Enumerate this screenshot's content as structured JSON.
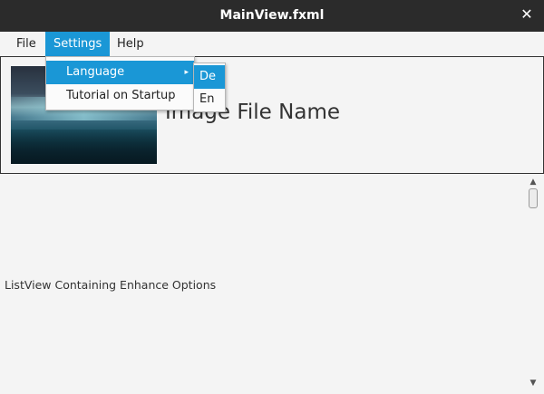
{
  "window": {
    "title": "MainView.fxml",
    "close_glyph": "✕"
  },
  "menubar": {
    "items": [
      {
        "label": "File"
      },
      {
        "label": "Settings"
      },
      {
        "label": "Help"
      }
    ]
  },
  "settings_menu": {
    "items": [
      {
        "label": "Language",
        "arrow": "▸"
      },
      {
        "label": "Tutorial on Startup"
      }
    ]
  },
  "language_submenu": {
    "items": [
      {
        "label": "De"
      },
      {
        "label": "En"
      }
    ]
  },
  "header": {
    "image_file_name": "Image File Name"
  },
  "list": {
    "placeholder": "ListView Containing Enhance Options"
  },
  "scrollbar": {
    "up_glyph": "▲",
    "down_glyph": "▼"
  },
  "colors": {
    "accent": "#1a97d6",
    "titlebar": "#2b2b2b",
    "background": "#f4f4f4"
  }
}
